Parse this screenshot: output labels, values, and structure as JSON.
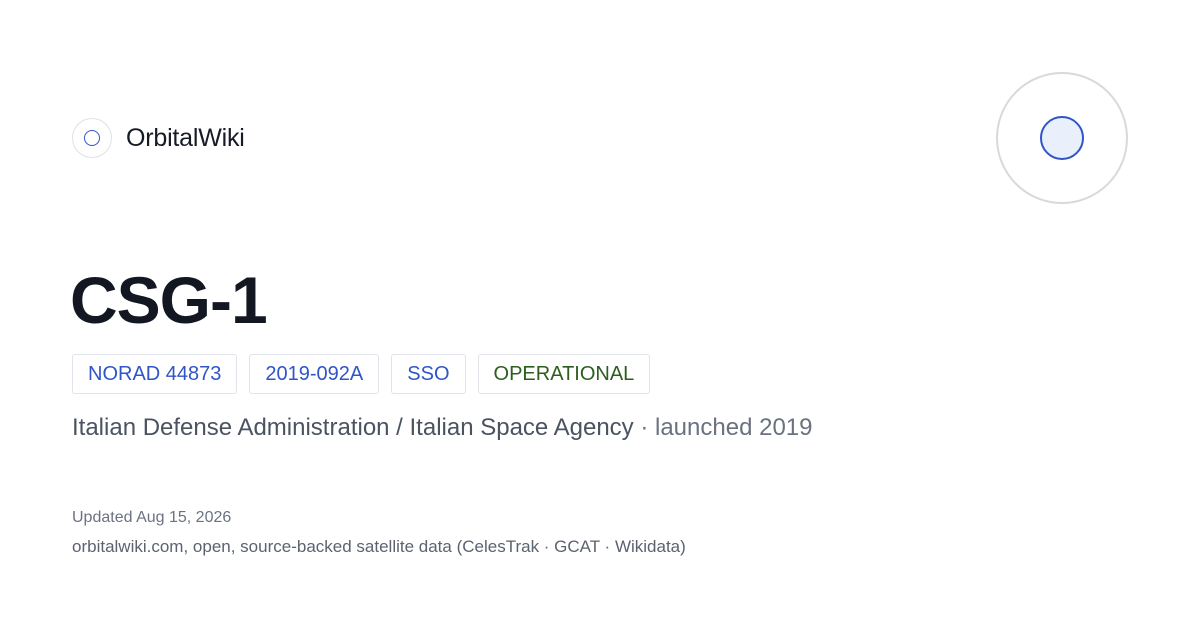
{
  "brand": {
    "name": "OrbitalWiki",
    "logo_icon": "orbit-ring-icon"
  },
  "hero_icon": "satellite-orbit-icon",
  "colors": {
    "accent": "#2f55c8",
    "status_ok": "#2c5e1e",
    "text": "#121722"
  },
  "satellite": {
    "name": "CSG-1",
    "tags": [
      {
        "label": "NORAD 44873",
        "kind": "norad"
      },
      {
        "label": "2019-092A",
        "kind": "cospar"
      },
      {
        "label": "SSO",
        "kind": "orbit"
      },
      {
        "label": "OPERATIONAL",
        "kind": "status"
      }
    ],
    "operator": "Italian Defense Administration /  Italian Space Agency",
    "launched": "· launched 2019"
  },
  "meta": {
    "updated_label": "Updated",
    "updated_date": "Aug 15, 2026",
    "footer": "orbitalwiki.com,  open, source-backed  satellite  data (CelesTrak  · GCAT · Wikidata)"
  }
}
